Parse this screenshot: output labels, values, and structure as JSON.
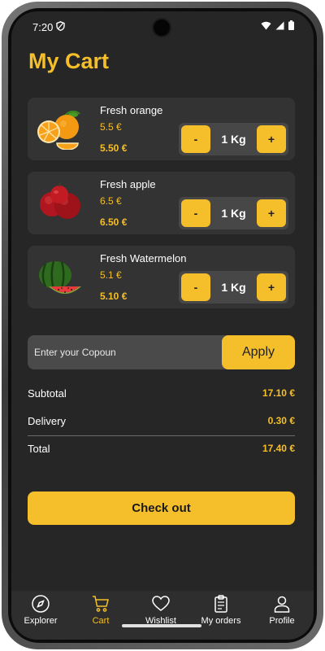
{
  "status": {
    "time": "7:20"
  },
  "page_title": "My Cart",
  "cart_items": [
    {
      "name": "Fresh orange",
      "unit_price": "5.5 €",
      "total": "5.50 €",
      "qty": "1 Kg",
      "fruit": "orange-icon"
    },
    {
      "name": "Fresh apple",
      "unit_price": "6.5 €",
      "total": "6.50 €",
      "qty": "1 Kg",
      "fruit": "apple-icon"
    },
    {
      "name": "Fresh Watermelon",
      "unit_price": "5.1 €",
      "total": "5.10 €",
      "qty": "1 Kg",
      "fruit": "watermelon-icon"
    }
  ],
  "stepper": {
    "minus": "-",
    "plus": "+"
  },
  "coupon": {
    "placeholder": "Enter your Copoun",
    "apply_label": "Apply"
  },
  "summary": {
    "subtotal_label": "Subtotal",
    "subtotal_value": "17.10 €",
    "delivery_label": "Delivery",
    "delivery_value": "0.30 €",
    "total_label": "Total",
    "total_value": "17.40 €"
  },
  "checkout_label": "Check out",
  "nav": [
    {
      "label": "Explorer",
      "icon": "compass-icon"
    },
    {
      "label": "Cart",
      "icon": "cart-icon",
      "active": true
    },
    {
      "label": "Wishlist",
      "icon": "heart-icon"
    },
    {
      "label": "My orders",
      "icon": "clipboard-icon"
    },
    {
      "label": "Profile",
      "icon": "user-icon"
    }
  ],
  "colors": {
    "accent": "#f4bf2a",
    "background": "#262626",
    "card": "#333333"
  }
}
